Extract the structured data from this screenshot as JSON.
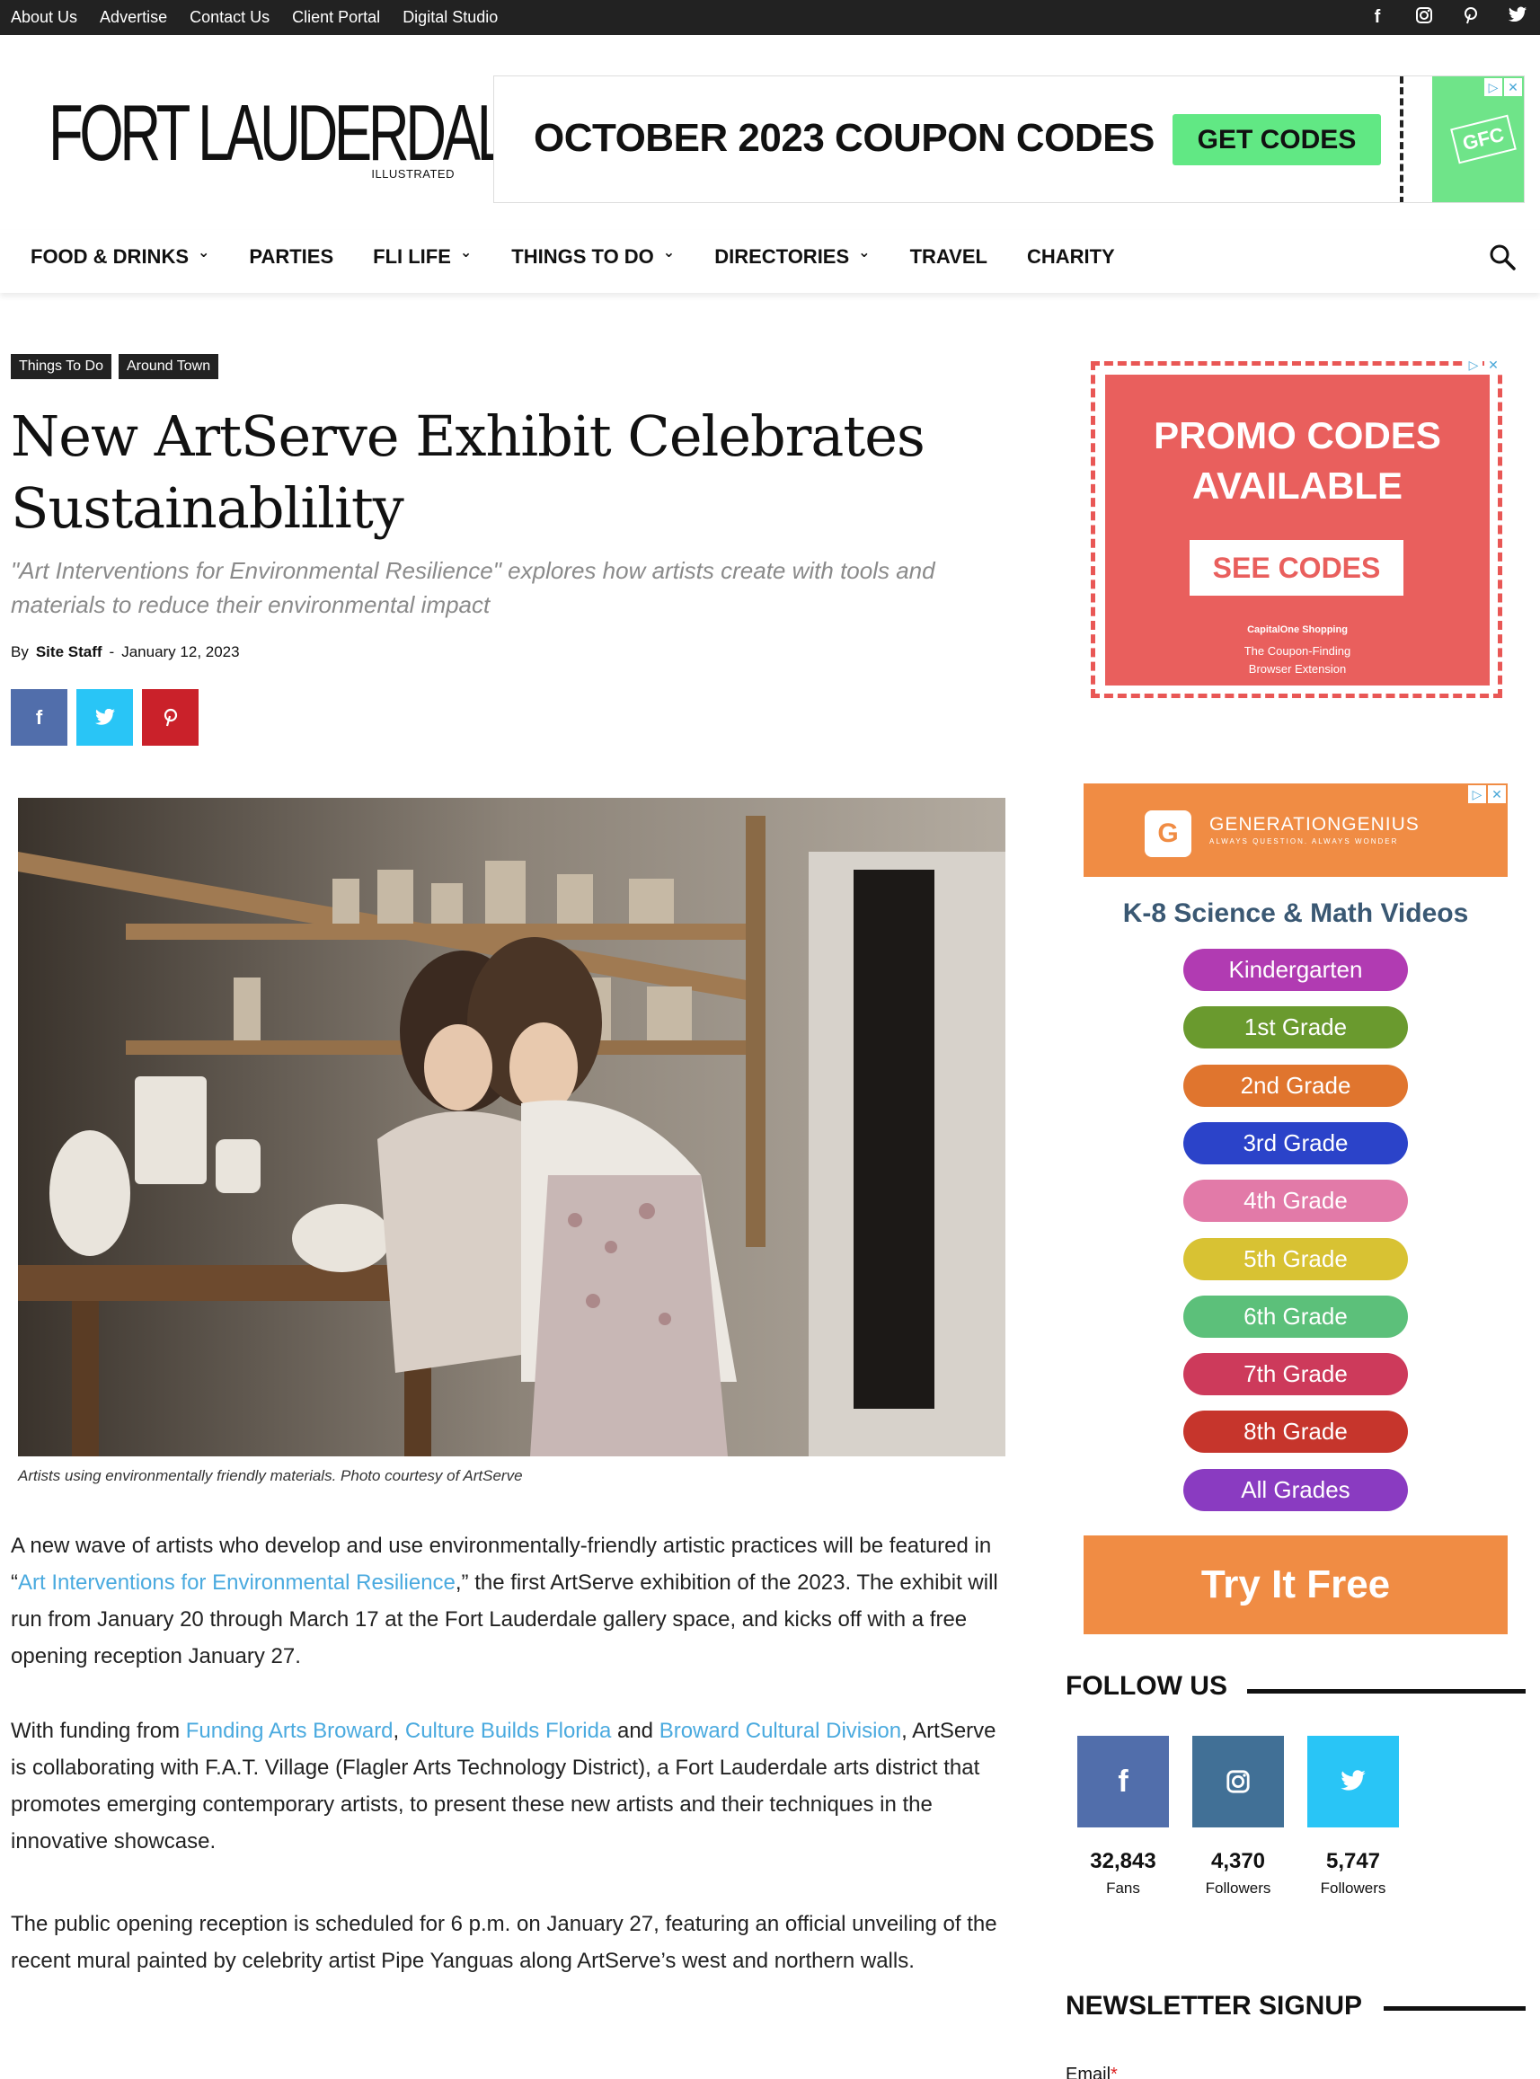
{
  "topbar": {
    "links": [
      "About Us",
      "Advertise",
      "Contact Us",
      "Client Portal",
      "Digital Studio"
    ],
    "social": [
      "f",
      "◎",
      "𝒑",
      "🐦"
    ],
    "social_icons": [
      "facebook-icon",
      "instagram-icon",
      "pinterest-icon",
      "twitter-icon"
    ]
  },
  "logo": {
    "main": "FORT LAUDERDALE",
    "sub": "ILLUSTRATED"
  },
  "top_ad": {
    "headline": "OCTOBER 2023 COUPON CODES",
    "button": "GET CODES",
    "badge": "GFC"
  },
  "nav": {
    "items": [
      {
        "label": "FOOD & DRINKS",
        "chevron": true
      },
      {
        "label": "PARTIES",
        "chevron": false
      },
      {
        "label": "FLI LIFE",
        "chevron": true
      },
      {
        "label": "THINGS TO DO",
        "chevron": true
      },
      {
        "label": "DIRECTORIES",
        "chevron": true
      },
      {
        "label": "TRAVEL",
        "chevron": false
      },
      {
        "label": "CHARITY",
        "chevron": false
      }
    ]
  },
  "article": {
    "tags": [
      "Things To Do",
      "Around Town"
    ],
    "title": "New ArtServe Exhibit Celebrates Sustainablility",
    "subtitle": "\"Art Interventions for Environmental Resilience\" explores how artists create with tools and materials to reduce their environmental impact",
    "by": "By",
    "author": "Site Staff",
    "sep": "-",
    "date": "January 12, 2023",
    "share": [
      {
        "icon": "facebook-icon",
        "glyph": "f",
        "color": "#516eab"
      },
      {
        "icon": "twitter-icon",
        "glyph": "🐦",
        "color": "#29c5f6"
      },
      {
        "icon": "pinterest-icon",
        "glyph": "P",
        "color": "#ca212a"
      }
    ],
    "caption": "Artists using environmentally friendly materials. Photo courtesy of ArtServe",
    "p1": {
      "a": "A new wave of artists who develop and use environmentally-friendly artistic practices will be featured in “",
      "link": "Art Interventions for Environmental Resilience",
      "b": ",” the first ArtServe exhibition of the 2023. The exhibit will run from January 20 through March 17 at the Fort Lauderdale gallery space, and kicks off with a free opening reception January 27."
    },
    "p2": {
      "a": "With funding from ",
      "link1": "Funding Arts Broward",
      "c1": ", ",
      "link2": "Culture Builds Florida",
      "c2": " and ",
      "link3": "Broward Cultural Division",
      "b": ", ArtServe is collaborating with F.A.T. Village (Flagler Arts Technology District), a Fort Lauderdale arts district that promotes emerging contemporary artists, to present these new artists and their techniques in the innovative showcase."
    },
    "p3": "The public opening reception is scheduled for 6 p.m. on January 27, featuring an official unveiling of the recent mural painted by celebrity artist Pipe Yanguas along ArtServe’s west and northern walls."
  },
  "sidebar": {
    "promo_ad": {
      "line1": "PROMO CODES",
      "line2": "AVAILABLE",
      "button": "SEE CODES",
      "brand": "CapitalOne Shopping",
      "tag1": "The Coupon-Finding",
      "tag2": "Browser Extension"
    },
    "gg_ad": {
      "logo": "G",
      "name": "GENERATIONGENIUS",
      "tagline": "ALWAYS QUESTION. ALWAYS WONDER",
      "heading": "K-8 Science & Math Videos",
      "grades": [
        {
          "label": "Kindergarten",
          "color": "#b13bb2"
        },
        {
          "label": "1st Grade",
          "color": "#6a9a2e"
        },
        {
          "label": "2nd Grade",
          "color": "#e0752e"
        },
        {
          "label": "3rd Grade",
          "color": "#2b43c9"
        },
        {
          "label": "4th Grade",
          "color": "#e27aa8"
        },
        {
          "label": "5th Grade",
          "color": "#d8c233"
        },
        {
          "label": "6th Grade",
          "color": "#5cc07a"
        },
        {
          "label": "7th Grade",
          "color": "#cd3a5b"
        },
        {
          "label": "8th Grade",
          "color": "#c6352c"
        },
        {
          "label": "All Grades",
          "color": "#8a3bc1"
        }
      ],
      "cta": "Try It Free"
    },
    "follow": {
      "heading": "FOLLOW US",
      "items": [
        {
          "icon": "facebook-icon",
          "glyph": "f",
          "color": "#516eab",
          "count": "32,843",
          "label": "Fans"
        },
        {
          "icon": "instagram-icon",
          "glyph": "◎",
          "color": "#417096",
          "count": "4,370",
          "label": "Followers"
        },
        {
          "icon": "twitter-icon",
          "glyph": "🐦",
          "color": "#29c5f6",
          "count": "5,747",
          "label": "Followers"
        }
      ]
    },
    "newsletter": {
      "heading": "NEWSLETTER SIGNUP",
      "email_label": "Email",
      "required": "*"
    }
  }
}
